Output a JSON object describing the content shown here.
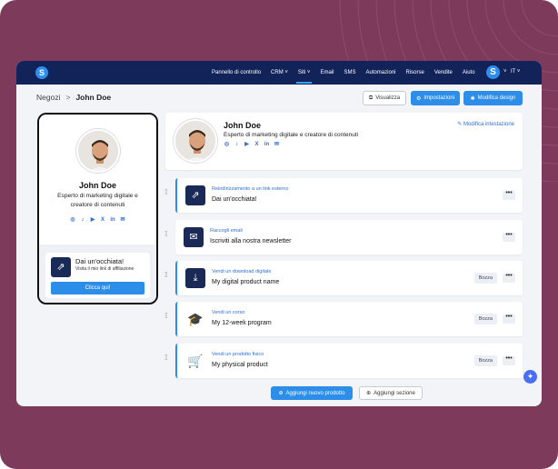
{
  "nav": {
    "items": [
      {
        "label": "Pannello di controllo",
        "active": false
      },
      {
        "label": "CRM",
        "dropdown": true,
        "active": false
      },
      {
        "label": "Siti",
        "dropdown": true,
        "active": true
      },
      {
        "label": "Email",
        "active": false
      },
      {
        "label": "SMS",
        "active": false
      },
      {
        "label": "Automazioni",
        "active": false
      },
      {
        "label": "Risorse",
        "active": false
      },
      {
        "label": "Vendite",
        "active": false
      },
      {
        "label": "Aiuto",
        "active": false
      }
    ],
    "logo_letter": "S",
    "user_letter": "S",
    "language": "IT"
  },
  "breadcrumb": {
    "parent": "Negozi",
    "separator": ">",
    "current": "John Doe"
  },
  "toolbar": {
    "preview_label": "Visualizza",
    "settings_label": "Impostazioni",
    "edit_design_label": "Modifica design"
  },
  "profile": {
    "name": "John Doe",
    "bio": "Esperto di marketing digitale e creatore di contenuti",
    "social_icons": [
      "instagram-icon",
      "tiktok-icon",
      "youtube-icon",
      "x-icon",
      "linkedin-icon",
      "email-icon"
    ]
  },
  "phone_preview": {
    "promo_title": "Dai un'occhiata!",
    "promo_subtitle": "Visita il mio link di affiliazione",
    "promo_button": "Clicca qui!"
  },
  "header_card": {
    "edit_label": "Modifica intestazione"
  },
  "items": [
    {
      "type_label": "Reindirizzamento a un link esterno",
      "title": "Dai un'occhiata!",
      "icon": "external-link-icon",
      "badge": "",
      "accent": true
    },
    {
      "type_label": "Raccogli email",
      "title": "Iscriviti alla nostra newsletter",
      "icon": "envelope-icon",
      "badge": "",
      "accent": false
    },
    {
      "type_label": "Vendi un download digitale",
      "title": "My digital product name",
      "icon": "download-icon",
      "badge": "Bozza",
      "accent": true
    },
    {
      "type_label": "Vendi un corso",
      "title": "My 12-week program",
      "icon": "graduation-cap-icon",
      "badge": "Bozza",
      "accent": true
    },
    {
      "type_label": "Vendi un prodotto fisico",
      "title": "My physical product",
      "icon": "cart-icon",
      "badge": "Bozza",
      "accent": true
    }
  ],
  "more_label": "•••",
  "actions": {
    "add_product": "Aggiungi nuovo prodotto",
    "add_section": "Aggiungi sezione"
  },
  "colors": {
    "background": "#7d3a5b",
    "nav": "#12235a",
    "accent": "#2c8ee8",
    "icon_box": "#1a2a57",
    "link": "#2c6fd0"
  }
}
